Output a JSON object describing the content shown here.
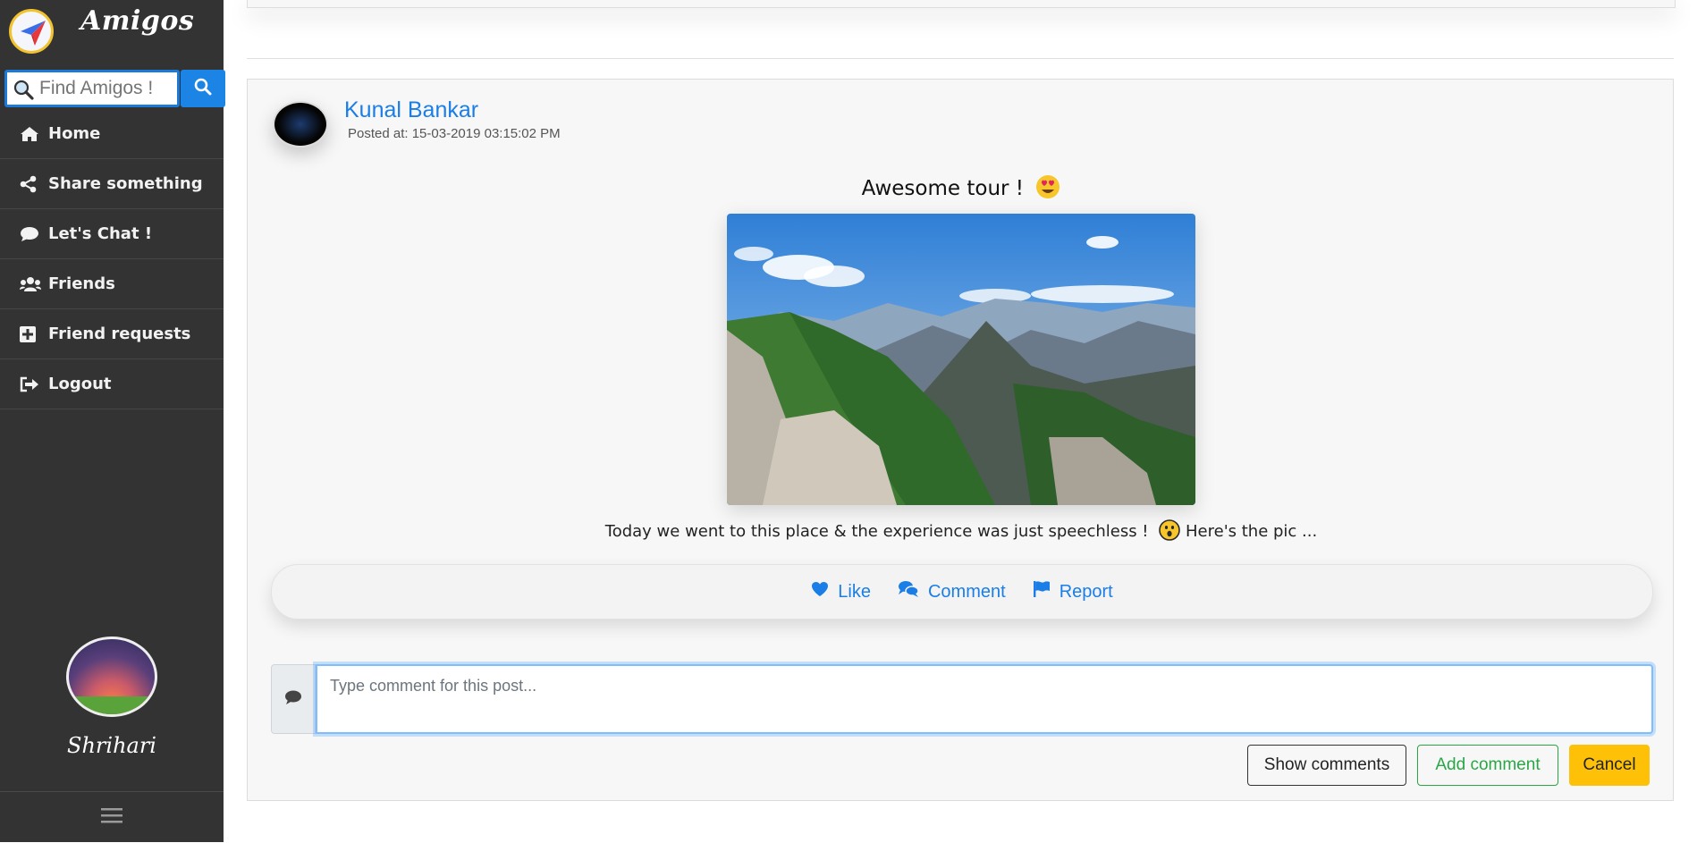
{
  "app": {
    "brand": "Amigos"
  },
  "search": {
    "placeholder": "Find Amigos !"
  },
  "nav": {
    "items": [
      {
        "label": "Home",
        "icon": "home-icon"
      },
      {
        "label": "Share something",
        "icon": "share-icon"
      },
      {
        "label": "Let's Chat !",
        "icon": "chat-icon"
      },
      {
        "label": "Friends",
        "icon": "users-icon"
      },
      {
        "label": "Friend requests",
        "icon": "plus-square-icon"
      },
      {
        "label": "Logout",
        "icon": "logout-icon"
      }
    ]
  },
  "user": {
    "name": "Shrihari"
  },
  "post": {
    "author": "Kunal Bankar",
    "posted_at": "Posted at: 15-03-2019 03:15:02 PM",
    "title": "Awesome tour !",
    "text": "Today we went to this place & the experience was just speechless !",
    "text_tail": "Here's the pic ...",
    "actions": {
      "like": "Like",
      "comment": "Comment",
      "report": "Report"
    }
  },
  "comment": {
    "placeholder": "Type comment for this post...",
    "show_label": "Show comments",
    "add_label": "Add comment",
    "cancel_label": "Cancel"
  },
  "colors": {
    "sidebar": "#333333",
    "accent": "#1a7ee6",
    "success": "#28a745",
    "warning": "#ffc107"
  }
}
